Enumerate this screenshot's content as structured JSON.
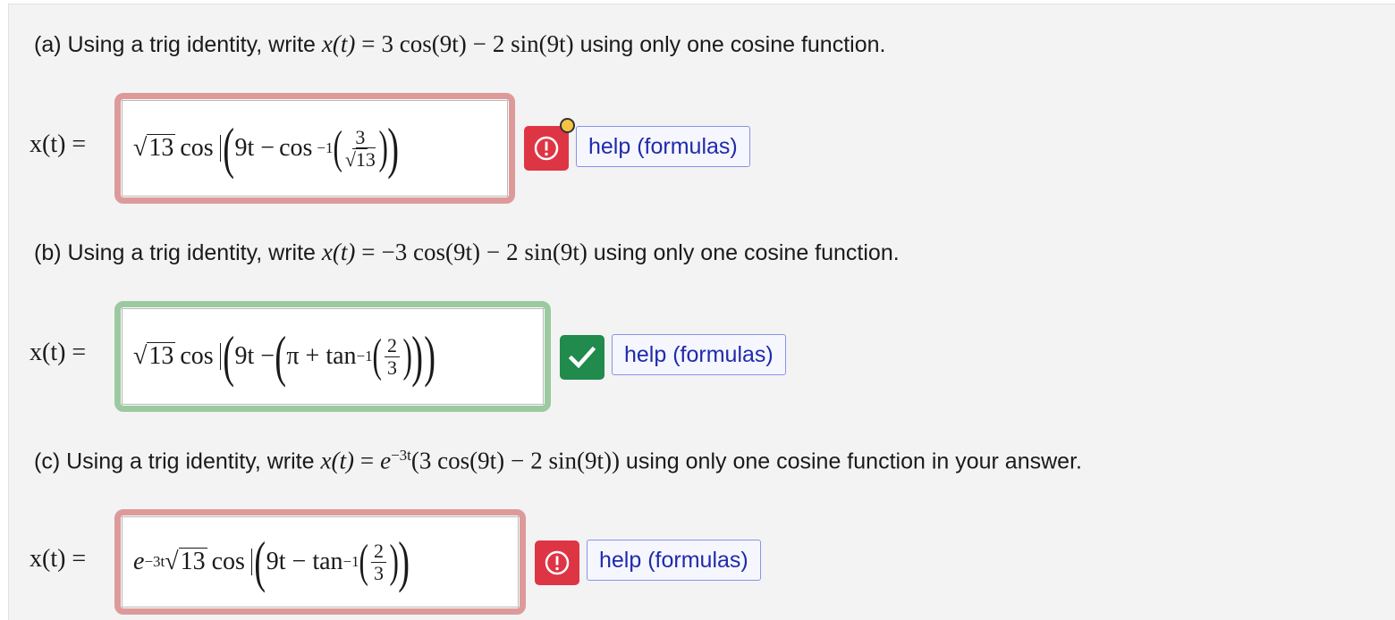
{
  "colors": {
    "error_border": "#dd9a9a",
    "correct_border": "#9cc9a0",
    "error_icon": "#de3545",
    "correct_icon": "#218a4d",
    "help_text": "#1f2baa",
    "warning_dot": "#f6c343"
  },
  "icons": {
    "error": "exclamation-circle-icon",
    "correct": "check-icon",
    "warning": "warning-dot-icon"
  },
  "questions": [
    {
      "prefix": "(a) Using a trig identity, write",
      "lhs": "x(t)",
      "eq": "=",
      "a": "3 cos(9t)",
      "minus": "−",
      "b": "2 sin(9t)",
      "suffix": "using only one cosine function.",
      "answer_label": "x(t) =",
      "answer": {
        "coef": "13",
        "fn": "cos",
        "inner": "9t − ",
        "inv": "cos",
        "invexp": "−1",
        "num": "3",
        "den": "13"
      },
      "status": "incorrect",
      "help": "help (formulas)"
    },
    {
      "prefix": "(b) Using a trig identity, write",
      "lhs": "x(t)",
      "eq": "=",
      "a": "−3 cos(9t)",
      "minus": "−",
      "b": "2 sin(9t)",
      "suffix": "using only one cosine function.",
      "answer_label": "x(t) =",
      "answer": {
        "coef": "13",
        "fn": "cos",
        "inner": "9t − ",
        "pi": "π + tan",
        "invexp": "−1",
        "num": "2",
        "den": "3"
      },
      "status": "correct",
      "help": "help (formulas)"
    },
    {
      "prefix": "(c) Using a trig identity, write",
      "lhs": "x(t)",
      "eq": "=",
      "e": "e",
      "eexp": "−3t",
      "a": "(3 cos(9t)",
      "minus": "−",
      "b": "2 sin(9t))",
      "suffix": "using only one cosine function in your answer.",
      "answer_label": "x(t) =",
      "answer": {
        "e": "e",
        "eexp": "−3t",
        "coef": "13",
        "fn": "cos",
        "inner": "9t − tan",
        "invexp": "−1",
        "num": "2",
        "den": "3"
      },
      "status": "incorrect",
      "help": "help (formulas)"
    }
  ]
}
